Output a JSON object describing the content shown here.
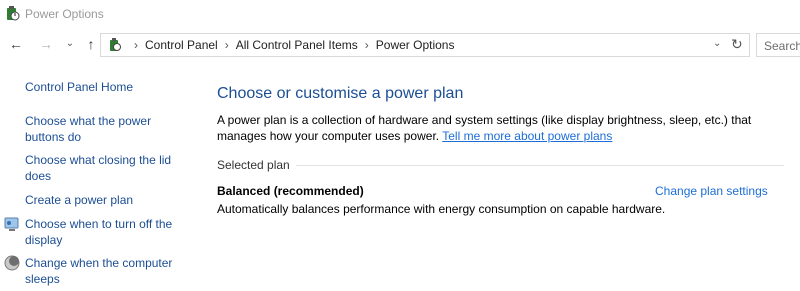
{
  "window": {
    "title": "Power Options"
  },
  "nav": {
    "back_icon": "back-arrow-icon",
    "forward_icon": "forward-arrow-icon",
    "recent_icon": "chevron-down-icon",
    "up_icon": "up-arrow-icon"
  },
  "address": {
    "crumbs": [
      "Control Panel",
      "All Control Panel Items",
      "Power Options"
    ]
  },
  "search": {
    "placeholder": "Search"
  },
  "sidebar": {
    "home": "Control Panel Home",
    "links": [
      "Choose what the power buttons do",
      "Choose what closing the lid does",
      "Create a power plan",
      "Choose when to turn off the display",
      "Change when the computer sleeps"
    ]
  },
  "main": {
    "heading": "Choose or customise a power plan",
    "desc_text": "A power plan is a collection of hardware and system settings (like display brightness, sleep, etc.) that manages how your computer uses power.",
    "desc_link": "Tell me more about power plans",
    "group_label": "Selected plan",
    "plan": {
      "name": "Balanced (recommended)",
      "change_link": "Change plan settings",
      "description": "Automatically balances performance with energy consumption on capable hardware."
    }
  },
  "colors": {
    "link": "#1c4e94",
    "link_accent": "#1c6ed6",
    "heading": "#1c4e94"
  }
}
